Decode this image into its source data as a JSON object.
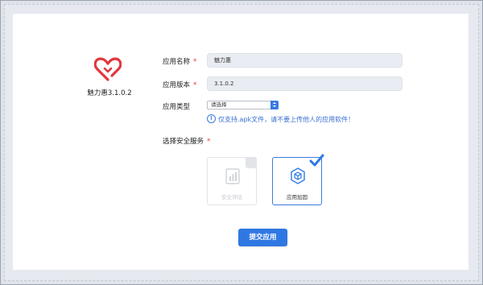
{
  "app": {
    "name": "魅力惠3.1.0.2",
    "logo_color": "#e0383e"
  },
  "form": {
    "name_label": "应用名称",
    "name_value": "魅力惠",
    "version_label": "应用版本",
    "version_value": "3.1.0.2",
    "type_label": "应用类型",
    "type_value": "请选择",
    "required_mark": "*",
    "tip_icon": "!",
    "tip_text": "仅支持.apk文件，请不要上传他人的应用软件！",
    "service_label": "选择安全服务"
  },
  "services": [
    {
      "label": "安全评估",
      "icon": "report-icon",
      "selected": false,
      "enabled": false
    },
    {
      "label": "应用加固",
      "icon": "cube-shield-icon",
      "selected": true,
      "enabled": true
    }
  ],
  "submit_label": "提交应用",
  "colors": {
    "accent": "#2f78e3",
    "required": "#e0383e",
    "tip": "#3a6fd0"
  }
}
